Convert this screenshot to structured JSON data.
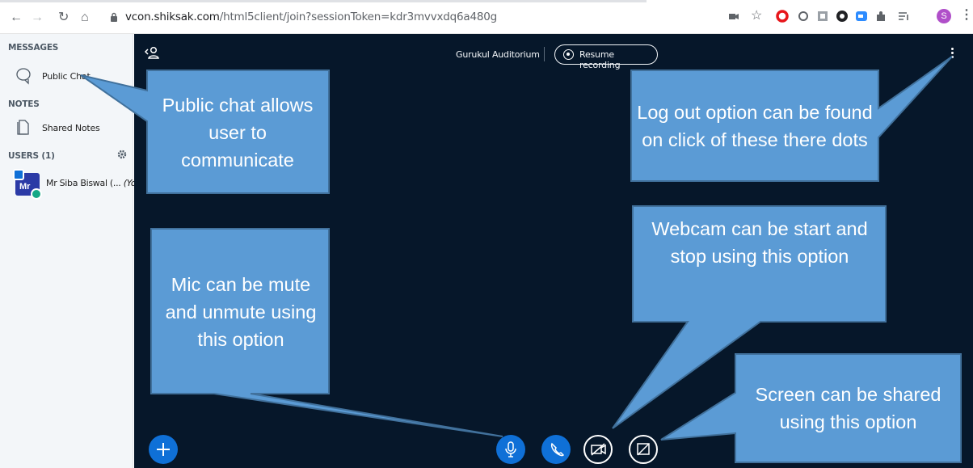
{
  "browser": {
    "url_host": "vcon.shiksak.com",
    "url_path": "/html5client/join?sessionToken=kdr3mvvxdq6a480g",
    "profile_initial": "S"
  },
  "sidebar": {
    "messages_title": "MESSAGES",
    "public_chat_label": "Public Chat",
    "notes_title": "NOTES",
    "shared_notes_label": "Shared Notes",
    "users_title": "USERS (1)",
    "user": {
      "initials": "Mr",
      "name": "Mr Siba Biswal (...",
      "you": "(You)"
    }
  },
  "main": {
    "room_name": "Gurukul Auditorium",
    "recording_label": "Resume recording"
  },
  "callouts": {
    "public_chat": "Public chat allows user to communicate",
    "logout": "Log out option can be found on click of these there dots",
    "mic": "Mic can be mute and unmute using this option",
    "webcam": "Webcam can be start and stop using this option",
    "screen": "Screen can be shared using this option"
  },
  "colors": {
    "main_bg": "#06172a",
    "sidebar_bg": "#f3f6f9",
    "accent_blue": "#0f70d7",
    "callout_fill": "#5b9bd5",
    "callout_border": "#41719c"
  }
}
